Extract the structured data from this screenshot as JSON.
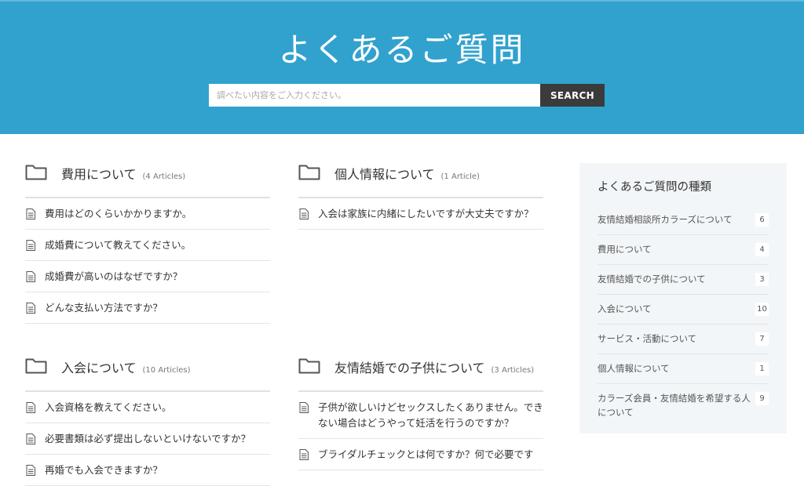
{
  "hero": {
    "title": "よくあるご質問",
    "search_placeholder": "調べたい内容をご入力ください。",
    "search_button": "SEARCH"
  },
  "categories": [
    {
      "title": "費用について",
      "count": "(4 Articles)",
      "items": [
        "費用はどのくらいかかりますか。",
        "成婚費について教えてください。",
        "成婚費が高いのはなぜですか？",
        "どんな支払い方法ですか？"
      ]
    },
    {
      "title": "個人情報について",
      "count": "(1 Article)",
      "items": [
        "入会は家族に内緒にしたいですが大丈夫ですか？"
      ]
    },
    {
      "title": "入会について",
      "count": "(10 Articles)",
      "items": [
        "入会資格を教えてください。",
        "必要書類は必ず提出しないといけないですか？",
        "再婚でも入会できますか？"
      ]
    },
    {
      "title": "友情結婚での子供について",
      "count": "(3 Articles)",
      "items": [
        "子供が欲しいけどセックスしたくありません。できない場合はどうやって妊活を行うのですか？",
        "ブライダルチェックとは何ですか？何で必要です"
      ]
    }
  ],
  "sidebar": {
    "title": "よくあるご質問の種類",
    "items": [
      {
        "label": "友情結婚相談所カラーズについて",
        "count": "6"
      },
      {
        "label": "費用について",
        "count": "4"
      },
      {
        "label": "友情結婚での子供について",
        "count": "3"
      },
      {
        "label": "入会について",
        "count": "10"
      },
      {
        "label": "サービス・活動について",
        "count": "7"
      },
      {
        "label": "個人情報について",
        "count": "1"
      },
      {
        "label": "カラーズ会員・友情結婚を希望する人について",
        "count": "9"
      }
    ]
  },
  "icons": {
    "folder": "folder-icon",
    "article": "document-icon"
  },
  "colors": {
    "hero_bg": "#31a2cd",
    "search_button_bg": "#3b3b3b",
    "sidebar_bg": "#f3f6f8"
  }
}
